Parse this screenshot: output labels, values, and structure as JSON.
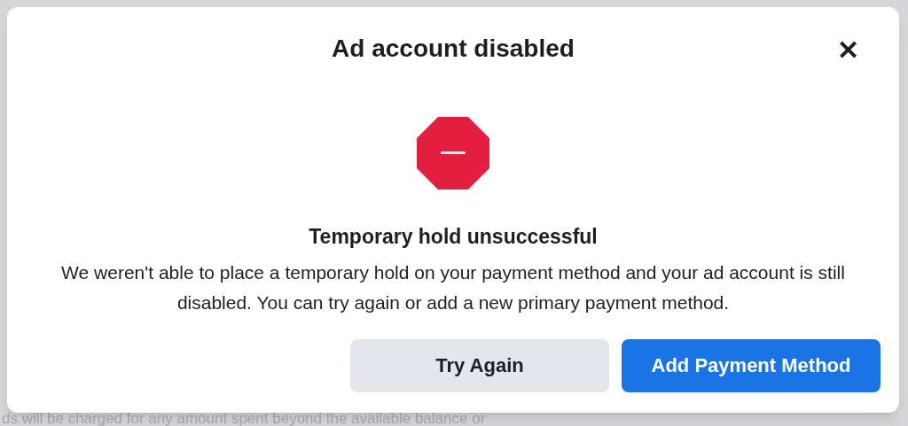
{
  "background": {
    "text": "ds will be charged for any amount spent beyond the available balance or"
  },
  "dialog": {
    "title": "Ad account disabled",
    "close": "✕",
    "heading": "Temporary hold unsuccessful",
    "message": "We weren't able to place a temporary hold on your payment method and your ad account is still disabled. You can try again or add a new primary payment method.",
    "buttons": [
      {
        "label": "Try Again",
        "kind": "secondary"
      },
      {
        "label": "Add Payment Method",
        "kind": "primary"
      }
    ]
  }
}
